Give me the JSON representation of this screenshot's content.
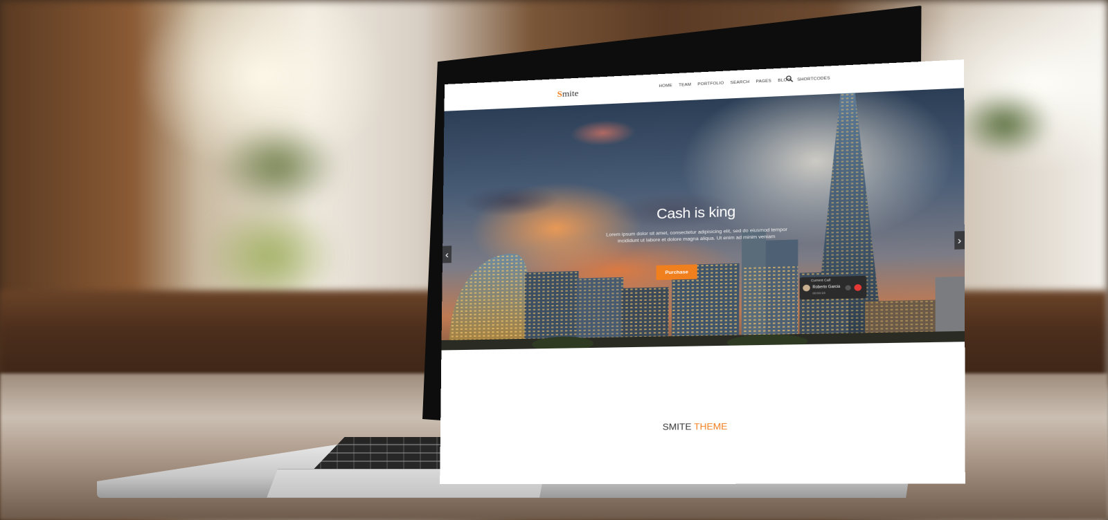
{
  "site": {
    "logo_initial": "S",
    "logo_rest": "mite"
  },
  "nav": {
    "items": [
      "HOME",
      "TEAM",
      "PORTFOLIO",
      "SEARCH",
      "PAGES",
      "BLOG",
      "SHORTCODES"
    ],
    "search_icon": "search-icon"
  },
  "hero": {
    "title": "Cash is king",
    "text": "Lorem ipsum dolor sit amet, consectetur adipisicing elit, sed do eiusmod tempor incididunt ut labore et dolore magna aliqua. Ut enim ad minim veniam",
    "button_label": "Purchase",
    "prev_arrow": "‹",
    "next_arrow": "›"
  },
  "call_widget": {
    "heading": "Current Call",
    "caller": "Roberto Garcia",
    "duration": "00:00:15"
  },
  "section": {
    "title_main": "SMITE",
    "title_accent": "THEME"
  },
  "colors": {
    "accent": "#f07f1e",
    "nav_text": "#333333",
    "hero_text": "#ffffff"
  }
}
